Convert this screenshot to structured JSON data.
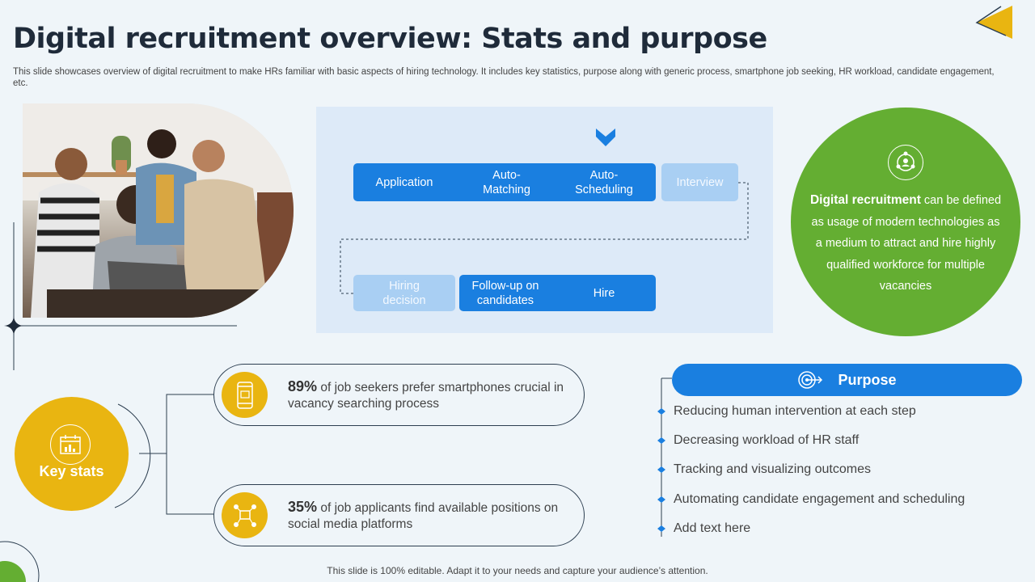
{
  "header": {
    "title": "Digital recruitment overview: Stats and purpose",
    "subtitle": "This slide showcases overview of digital recruitment to make HRs familiar with basic aspects of hiring technology. It includes key statistics, purpose along with generic process, smartphone job seeking, HR workload, candidate engagement, etc."
  },
  "process": {
    "steps": [
      "Application",
      "Auto-Matching",
      "Auto-Scheduling",
      "Interview",
      "Hiring decision",
      "Follow-up on candidates",
      "Hire"
    ]
  },
  "definition": {
    "bold": "Digital recruitment",
    "text": " can be defined as usage of modern technologies as a medium to attract and hire highly qualified workforce for multiple vacancies"
  },
  "key_stats": {
    "label": "Key stats",
    "items": [
      {
        "percent": "89%",
        "text": " of job seekers prefer smartphones crucial in vacancy searching process",
        "icon": "smartphone-icon"
      },
      {
        "percent": "35%",
        "text": " of job applicants find available positions on social media platforms",
        "icon": "social-network-icon"
      }
    ]
  },
  "purpose": {
    "title": "Purpose",
    "items": [
      "Reducing human intervention at each step",
      "Decreasing workload of HR staff",
      "Tracking and visualizing outcomes",
      "Automating candidate engagement and scheduling",
      "Add text here"
    ]
  },
  "footer": "This slide is 100% editable. Adapt it to your needs and capture your audience’s attention.",
  "colors": {
    "blue": "#1a7fe0",
    "light_blue": "#a9cff3",
    "green": "#64ae32",
    "yellow": "#e9b511",
    "background": "#eff5f9"
  }
}
